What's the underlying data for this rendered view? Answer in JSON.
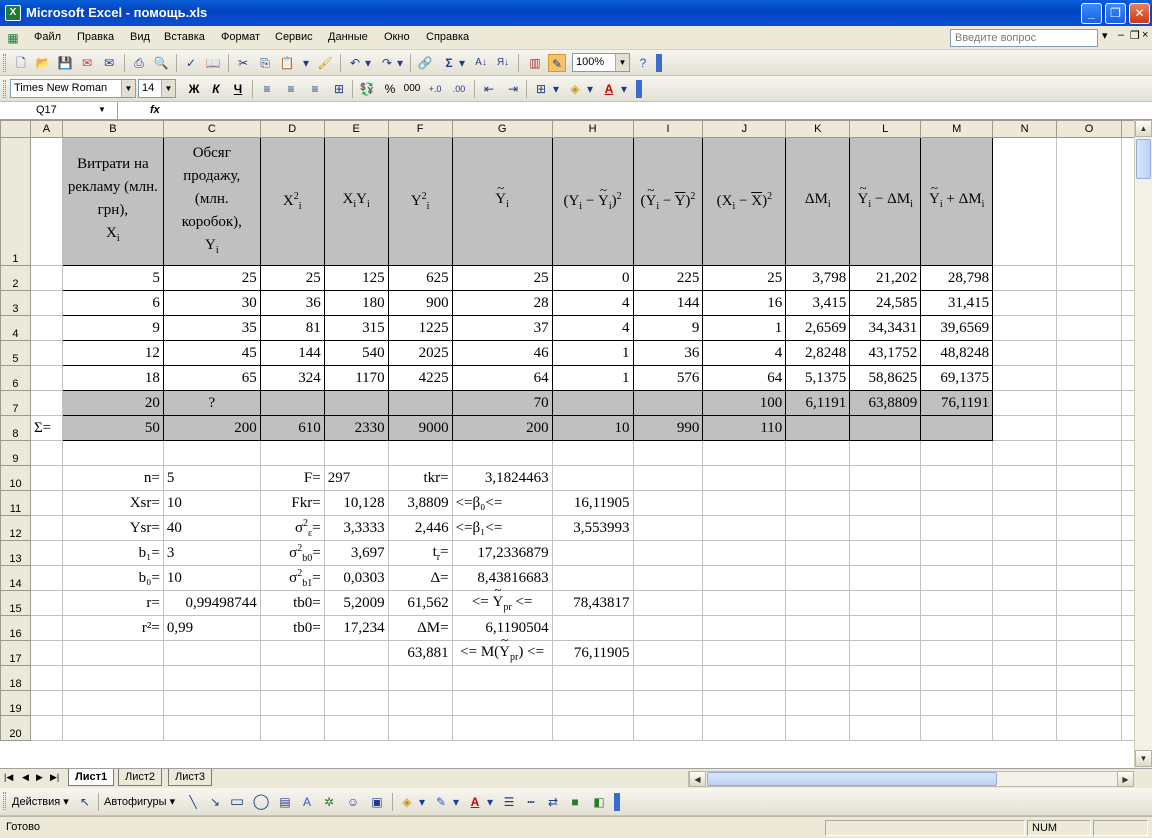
{
  "window": {
    "title": "Microsoft Excel - помощь.xls",
    "app_icon": "X"
  },
  "menu": {
    "items": [
      "Файл",
      "Правка",
      "Вид",
      "Вставка",
      "Формат",
      "Сервис",
      "Данные",
      "Окно",
      "Справка"
    ],
    "help_placeholder": "Введите вопрос"
  },
  "toolbar": {
    "zoom": "100%"
  },
  "format": {
    "font": "Times New Roman",
    "size": "14",
    "bold": "Ж",
    "italic": "К",
    "underline": "Ч",
    "percent": "%",
    "thousands": "000"
  },
  "formula_bar": {
    "cell_ref": "Q17",
    "fx": "fx",
    "content": ""
  },
  "columns": [
    "A",
    "B",
    "C",
    "D",
    "E",
    "F",
    "G",
    "H",
    "I",
    "J",
    "K",
    "L",
    "M",
    "N",
    "O"
  ],
  "rows": [
    "1",
    "2",
    "3",
    "4",
    "5",
    "6",
    "7",
    "8",
    "9",
    "10",
    "11",
    "12",
    "13",
    "14",
    "15",
    "16",
    "17",
    "18",
    "19",
    "20"
  ],
  "header": {
    "b_line1": "Витрати на рекламу (млн. грн),",
    "b_var": "X",
    "b_sub": "i",
    "c_line1": "Обсяг продажу, (млн. коробок),",
    "c_var": "Y",
    "c_sub": "i"
  },
  "data": [
    [
      "5",
      "25",
      "25",
      "125",
      "625",
      "25",
      "0",
      "225",
      "25",
      "3,798",
      "21,202",
      "28,798"
    ],
    [
      "6",
      "30",
      "36",
      "180",
      "900",
      "28",
      "4",
      "144",
      "16",
      "3,415",
      "24,585",
      "31,415"
    ],
    [
      "9",
      "35",
      "81",
      "315",
      "1225",
      "37",
      "4",
      "9",
      "1",
      "2,6569",
      "34,3431",
      "39,6569"
    ],
    [
      "12",
      "45",
      "144",
      "540",
      "2025",
      "46",
      "1",
      "36",
      "4",
      "2,8248",
      "43,1752",
      "48,8248"
    ],
    [
      "18",
      "65",
      "324",
      "1170",
      "4225",
      "64",
      "1",
      "576",
      "64",
      "5,1375",
      "58,8625",
      "69,1375"
    ]
  ],
  "row7": {
    "b": "20",
    "c": "?",
    "g": "70",
    "j": "100",
    "k": "6,1191",
    "l": "63,8809",
    "m": "76,1191"
  },
  "row8": {
    "a": "Σ=",
    "b": "50",
    "c": "200",
    "d": "610",
    "e": "2330",
    "f": "9000",
    "g": "200",
    "h": "10",
    "i": "990",
    "j": "110"
  },
  "stats": {
    "r10": {
      "b": "n=",
      "c": "5",
      "d": "F=",
      "e": "297",
      "f": "tkr=",
      "g": "3,1824463"
    },
    "r11": {
      "b": "Xsr=",
      "c": "10",
      "d": "Fkr=",
      "e": "10,128",
      "f": "3,8809",
      "g": "<=β₀<=",
      "h": "16,11905"
    },
    "r12": {
      "b": "Ysr=",
      "c": "40",
      "e": "3,3333",
      "f": "2,446",
      "g": "<=β₁<=",
      "h": "3,553993"
    },
    "r13": {
      "b": "b₁=",
      "c": "3",
      "e": "3,697",
      "g": "17,2336879"
    },
    "r14": {
      "b": "b₀=",
      "c": "10",
      "e": "0,0303",
      "f": "Δ=",
      "g": "8,43816683"
    },
    "r15": {
      "b": "r=",
      "c": "0,99498744",
      "d": "tb0=",
      "e": "5,2009",
      "f": "61,562",
      "h": "78,43817"
    },
    "r16": {
      "b": "r²=",
      "c": "0,99",
      "d": "tb0=",
      "e": "17,234",
      "f": "ΔM=",
      "g": "6,1190504"
    },
    "r17": {
      "f": "63,881",
      "h": "76,11905"
    }
  },
  "tabs": [
    "Лист1",
    "Лист2",
    "Лист3"
  ],
  "drawing": {
    "actions": "Действия",
    "autoshapes": "Автофигуры"
  },
  "status": {
    "left": "Готово",
    "num": "NUM"
  }
}
